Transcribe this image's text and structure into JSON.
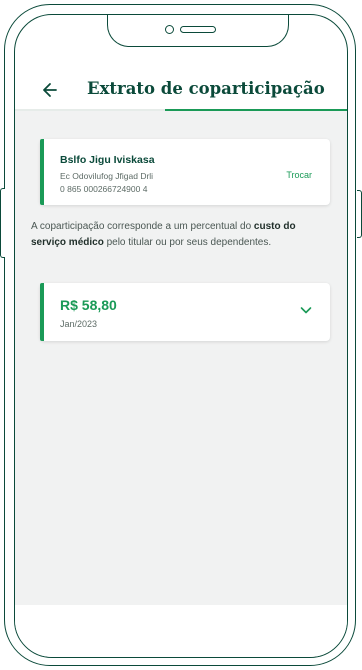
{
  "header": {
    "title": "Extrato de coparticipação",
    "back_icon": "arrow-left-icon"
  },
  "beneficiary": {
    "name": "Bslfo Jigu Iviskasa",
    "plan": "Ec Odovilufog Jfigad Drli",
    "card_number": "0 865 000266724900 4",
    "swap_label": "Trocar"
  },
  "info": {
    "text_before": "A coparticipação corresponde a um percentual do ",
    "text_bold": "custo do serviço médico",
    "text_after": " pelo titular ou por seus dependentes."
  },
  "statement": {
    "amount": "R$ 58,80",
    "period": "Jan/2023",
    "expand_icon": "chevron-down-icon"
  },
  "colors": {
    "brand_dark": "#0b4a3a",
    "brand_green": "#1a9a57",
    "background": "#f1f2f2"
  }
}
